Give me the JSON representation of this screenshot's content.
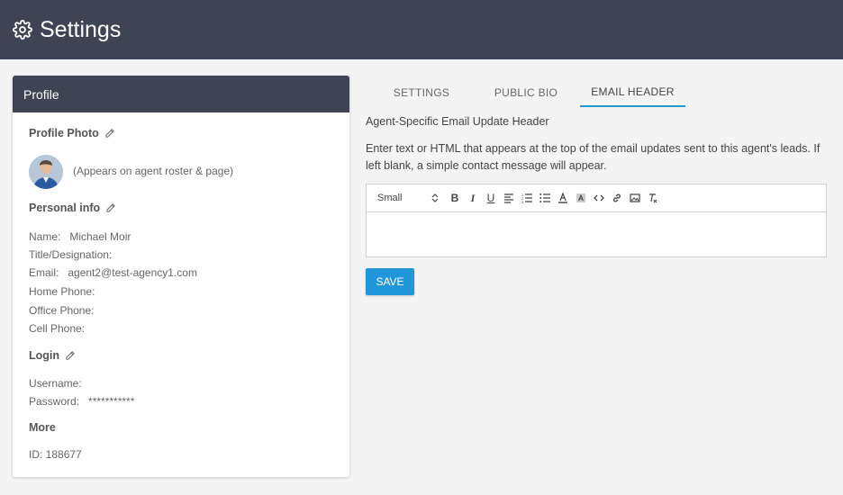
{
  "header": {
    "title": "Settings",
    "icon": "gear-icon"
  },
  "profile": {
    "card_title": "Profile",
    "photo_section": "Profile Photo",
    "photo_note": "(Appears on agent roster & page)",
    "personal_section": "Personal info",
    "fields": [
      {
        "label": "Name:",
        "value": "Michael Moir"
      },
      {
        "label": "Title/Designation:",
        "value": ""
      },
      {
        "label": "Email:",
        "value": "agent2@test-agency1.com"
      },
      {
        "label": "Home Phone:",
        "value": ""
      },
      {
        "label": "Office Phone:",
        "value": ""
      },
      {
        "label": "Cell Phone:",
        "value": ""
      }
    ],
    "login_section": "Login",
    "login_fields": [
      {
        "label": "Username:",
        "value": ""
      },
      {
        "label": "Password:",
        "value": "***********"
      }
    ],
    "more_section": "More",
    "id_text": "ID: 188677"
  },
  "tabs": [
    {
      "label": "SETTINGS",
      "active": false
    },
    {
      "label": "PUBLIC BIO",
      "active": false
    },
    {
      "label": "EMAIL HEADER",
      "active": true
    }
  ],
  "email_header": {
    "title": "Agent-Specific Email Update Header",
    "description": "Enter text or HTML that appears at the top of the email updates sent to this agent's leads. If left blank, a simple contact message will appear.",
    "size_select": "Small",
    "toolbar_tools": [
      "bold-icon",
      "italic-icon",
      "underline-icon",
      "align-icon",
      "ordered-list-icon",
      "bullet-list-icon",
      "text-color-icon",
      "background-color-icon",
      "code-icon",
      "link-icon",
      "image-icon",
      "clear-format-icon"
    ],
    "save_label": "SAVE"
  },
  "colors": {
    "topbar": "#3f4455",
    "accent": "#2196d9",
    "tab_underline": "#2196c9"
  }
}
